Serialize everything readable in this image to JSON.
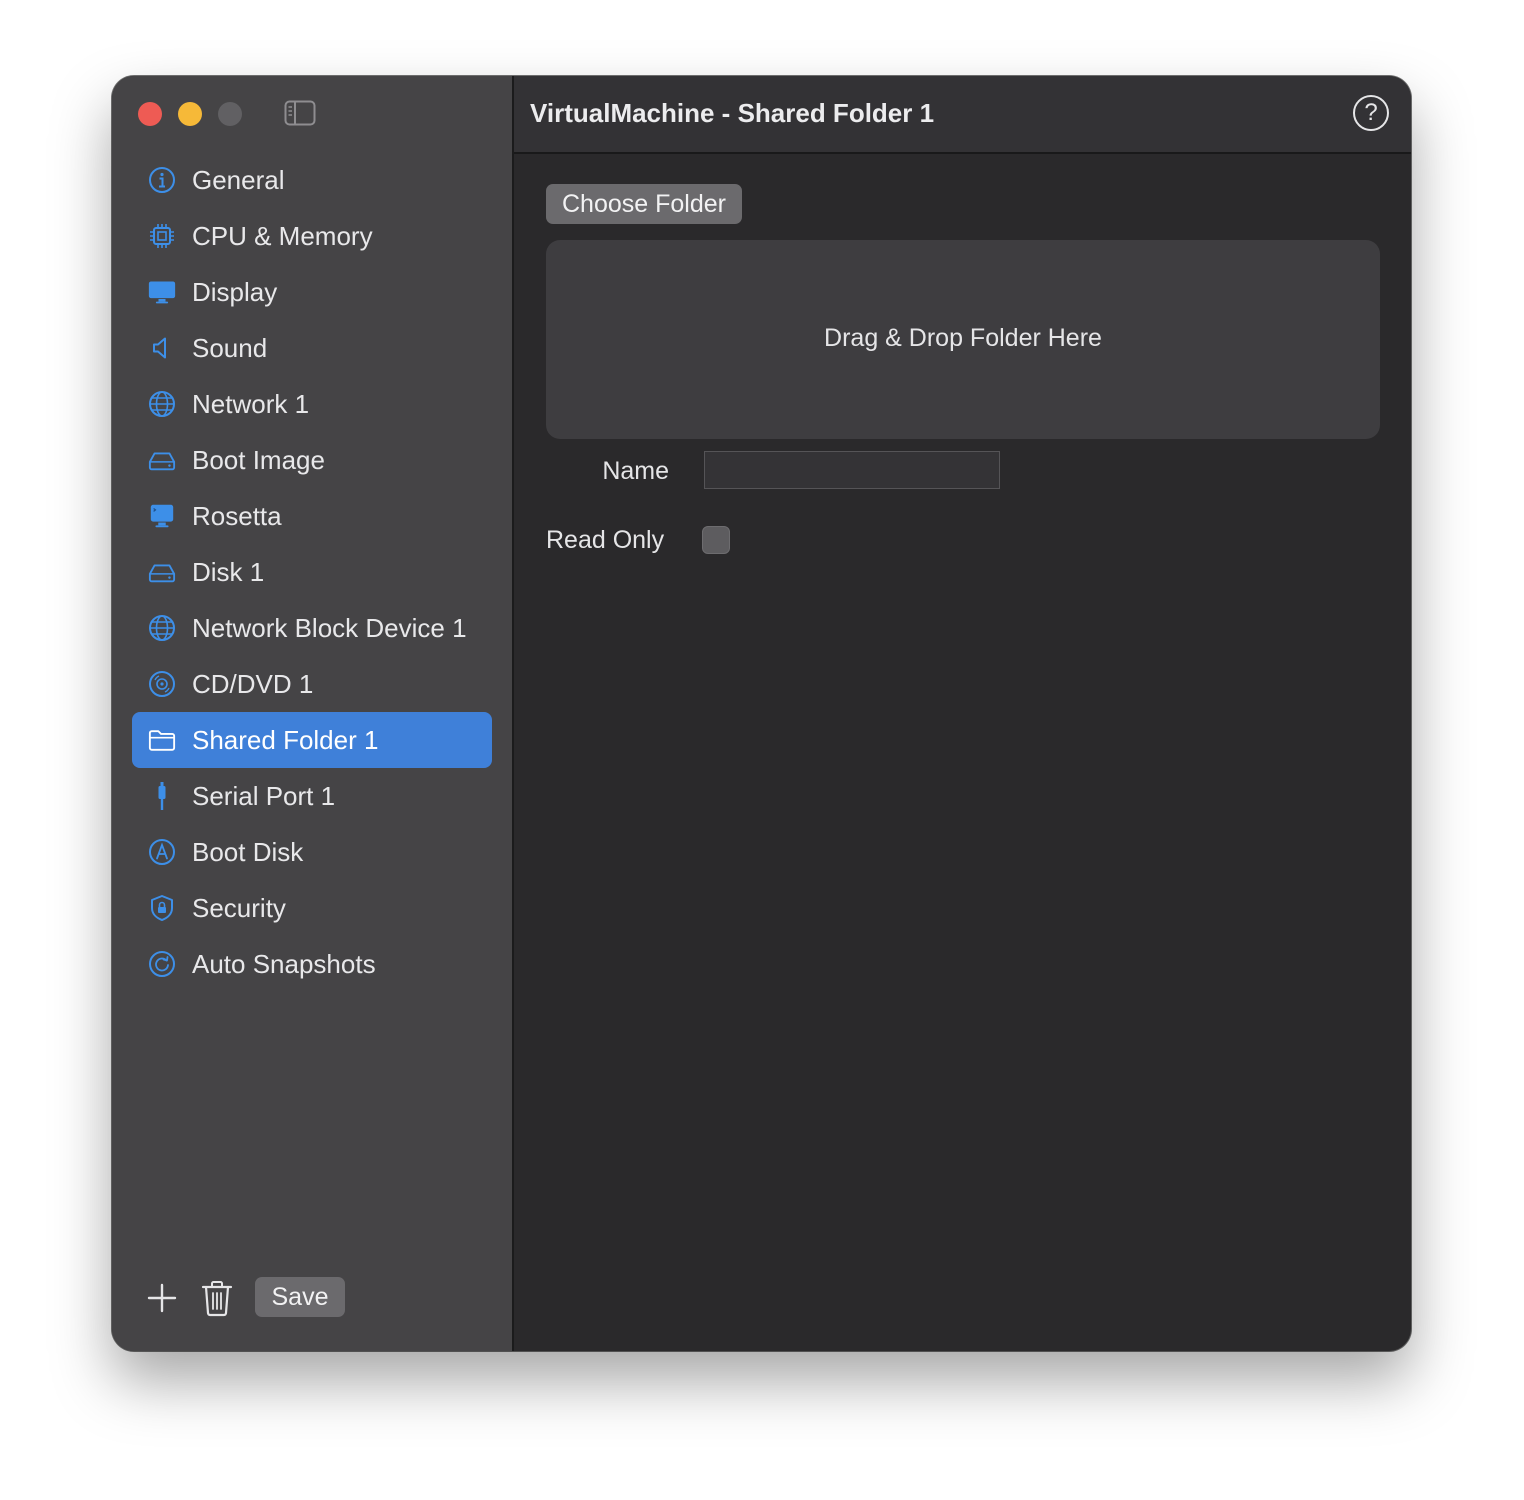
{
  "window": {
    "title": "VirtualMachine - Shared Folder 1"
  },
  "sidebar": {
    "items": [
      {
        "label": "General",
        "icon": "info-icon",
        "selected": false
      },
      {
        "label": "CPU & Memory",
        "icon": "cpu-icon",
        "selected": false
      },
      {
        "label": "Display",
        "icon": "display-icon",
        "selected": false
      },
      {
        "label": "Sound",
        "icon": "speaker-icon",
        "selected": false
      },
      {
        "label": "Network 1",
        "icon": "globe-icon",
        "selected": false
      },
      {
        "label": "Boot Image",
        "icon": "drive-icon",
        "selected": false
      },
      {
        "label": "Rosetta",
        "icon": "terminal-display-icon",
        "selected": false
      },
      {
        "label": "Disk 1",
        "icon": "drive-icon",
        "selected": false
      },
      {
        "label": "Network Block Device 1",
        "icon": "globe-icon",
        "selected": false
      },
      {
        "label": "CD/DVD 1",
        "icon": "disc-icon",
        "selected": false
      },
      {
        "label": "Shared Folder 1",
        "icon": "folder-icon",
        "selected": true
      },
      {
        "label": "Serial Port 1",
        "icon": "cable-connector-icon",
        "selected": false
      },
      {
        "label": "Boot Disk",
        "icon": "app-store-icon",
        "selected": false
      },
      {
        "label": "Security",
        "icon": "lock-shield-icon",
        "selected": false
      },
      {
        "label": "Auto Snapshots",
        "icon": "clock-arrow-icon",
        "selected": false
      }
    ]
  },
  "bottom_bar": {
    "add_icon": "plus-icon",
    "delete_icon": "trash-icon",
    "save_label": "Save"
  },
  "main": {
    "help_label": "?",
    "choose_folder_label": "Choose Folder",
    "drop_zone_text": "Drag & Drop Folder Here",
    "name_label": "Name",
    "name_value": "",
    "read_only_label": "Read Only",
    "read_only_checked": false
  },
  "colors": {
    "accent": "#3f80d9",
    "icon_blue": "#3d8fe8",
    "sidebar_bg": "#454446",
    "content_bg": "#2a292b",
    "close": "#ee5b54",
    "minimize": "#f6b938"
  }
}
